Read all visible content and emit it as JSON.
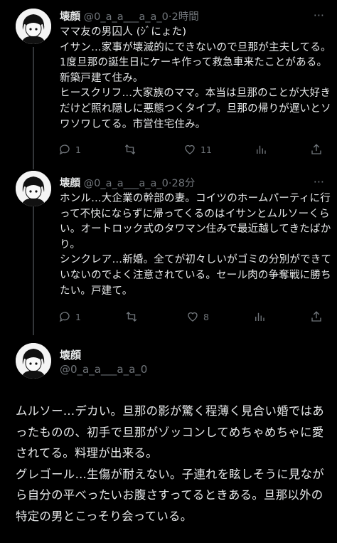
{
  "tweets": [
    {
      "name": "壊顔",
      "handle": "@0_a_a___a_a_0",
      "time": "2時間",
      "text": "ママ友の男囚人 (ｼﾞにょた)\nイサン…家事が壊滅的にできないので旦那が主夫してる。1度旦那の誕生日にケーキ作って救急車来たことがある。新築戸建て住み。\nヒースクリフ…大家族のママ。本当は旦那のことが大好きだけど照れ隠しに悪態つくタイプ。旦那の帰りが遅いとソワソワしてる。市営住宅住み。",
      "replies": "1",
      "retweets": "",
      "likes": "11"
    },
    {
      "name": "壊顔",
      "handle": "@0_a_a___a_a_0",
      "time": "28分",
      "text": "ホンル…大企業の幹部の妻。コイツのホームパーティに行って不快にならずに帰ってくるのはイサンとムルソーくらい。オートロック式のタワマン住みで最近越してきたばかり。\nシンクレア…新婚。全てが初々しいがゴミの分別ができていないのでよく注意されている。セール肉の争奪戦に勝ちたい。戸建て。",
      "replies": "1",
      "retweets": "",
      "likes": "8"
    }
  ],
  "main": {
    "name": "壊顔",
    "handle": "@0_a_a___a_a_0",
    "text": "ムルソー…デカい。旦那の影が驚く程薄く見合い婚ではあったものの、初手で旦那がゾッコンしてめちゃめちゃに愛されてる。料理が出来る。\nグレゴール…生傷が耐えない。子連れを眩しそうに見ながら自分の平べったいお腹さすってるときある。旦那以外の特定の男とこっそり会っている。"
  },
  "icons": [
    "more-icon",
    "reply-icon",
    "retweet-icon",
    "like-icon",
    "views-icon",
    "share-icon"
  ]
}
